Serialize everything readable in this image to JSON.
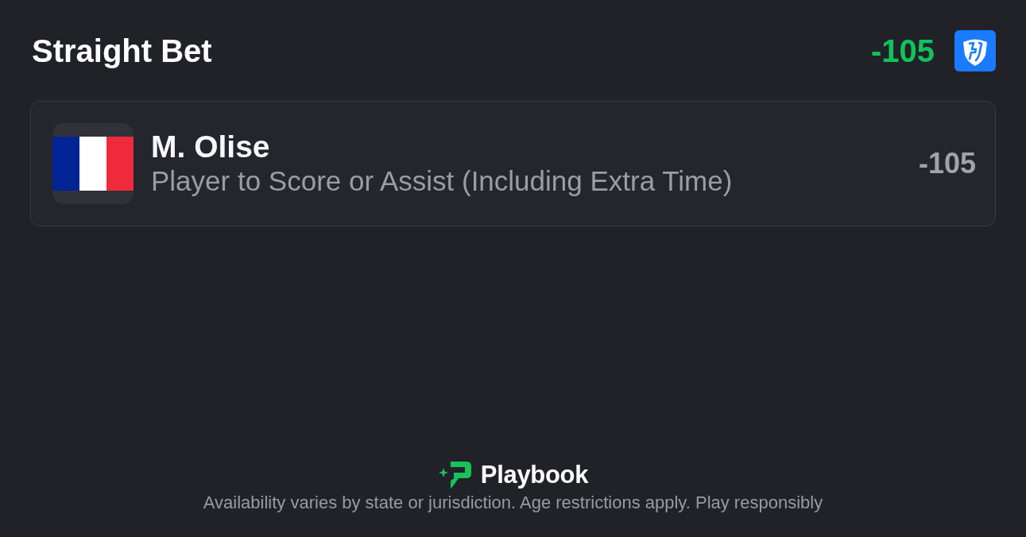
{
  "header": {
    "title": "Straight Bet",
    "odds": "-105"
  },
  "selection": {
    "player": "M. Olise",
    "market": "Player to Score or Assist (Including Extra Time)",
    "odds": "-105"
  },
  "footer": {
    "brand": "Playbook",
    "disclaimer": "Availability varies by state or jurisdiction. Age restrictions apply. Play responsibly"
  }
}
